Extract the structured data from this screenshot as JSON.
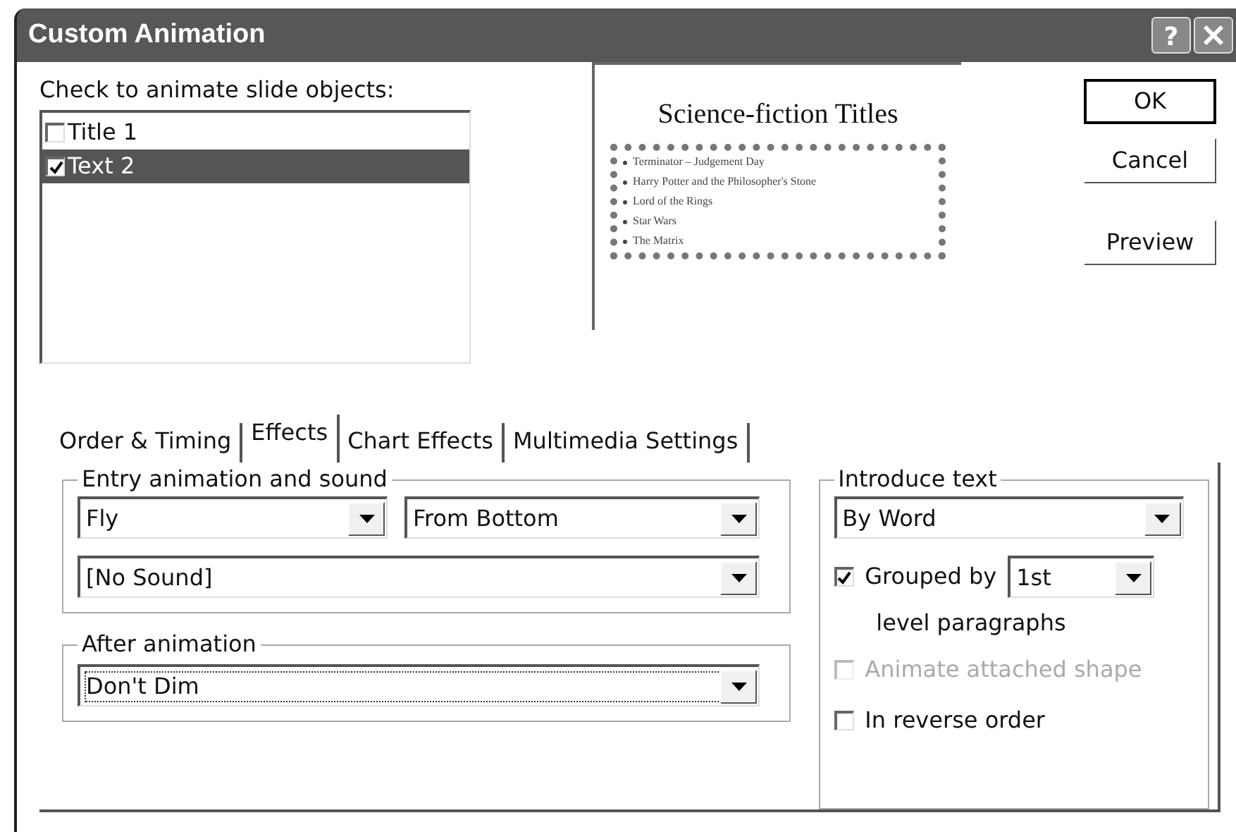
{
  "window": {
    "title": "Custom Animation",
    "help": "?"
  },
  "objects": {
    "label": "Check to animate slide objects:",
    "items": [
      {
        "label": "Title 1",
        "checked": false,
        "selected": false
      },
      {
        "label": "Text 2",
        "checked": true,
        "selected": true
      }
    ]
  },
  "preview": {
    "title": "Science-fiction Titles",
    "bullets": [
      "Terminator – Judgement Day",
      "Harry Potter and the Philosopher's Stone",
      "Lord of the Rings",
      "Star Wars",
      "The Matrix"
    ]
  },
  "buttons": [
    "OK",
    "Cancel",
    "Preview"
  ],
  "tabs": [
    {
      "label": "Order & Timing",
      "selected": false
    },
    {
      "label": "Effects",
      "selected": true
    },
    {
      "label": "Chart Effects",
      "selected": false
    },
    {
      "label": "Multimedia Settings",
      "selected": false
    }
  ],
  "entry": {
    "legend": "Entry animation and sound",
    "effect": "Fly",
    "direction": "From Bottom",
    "sound": "[No Sound]"
  },
  "after": {
    "legend": "After animation",
    "value": "Don't Dim",
    "focused": true
  },
  "introduce": {
    "legend": "Introduce text",
    "mode": "By Word",
    "grouped": {
      "label": "Grouped by",
      "checked": true,
      "level": "1st",
      "suffix": "level paragraphs"
    },
    "options": [
      {
        "label": "Animate attached shape",
        "checked": false,
        "disabled": true
      },
      {
        "label": "In reverse order",
        "checked": false,
        "disabled": false
      }
    ]
  }
}
